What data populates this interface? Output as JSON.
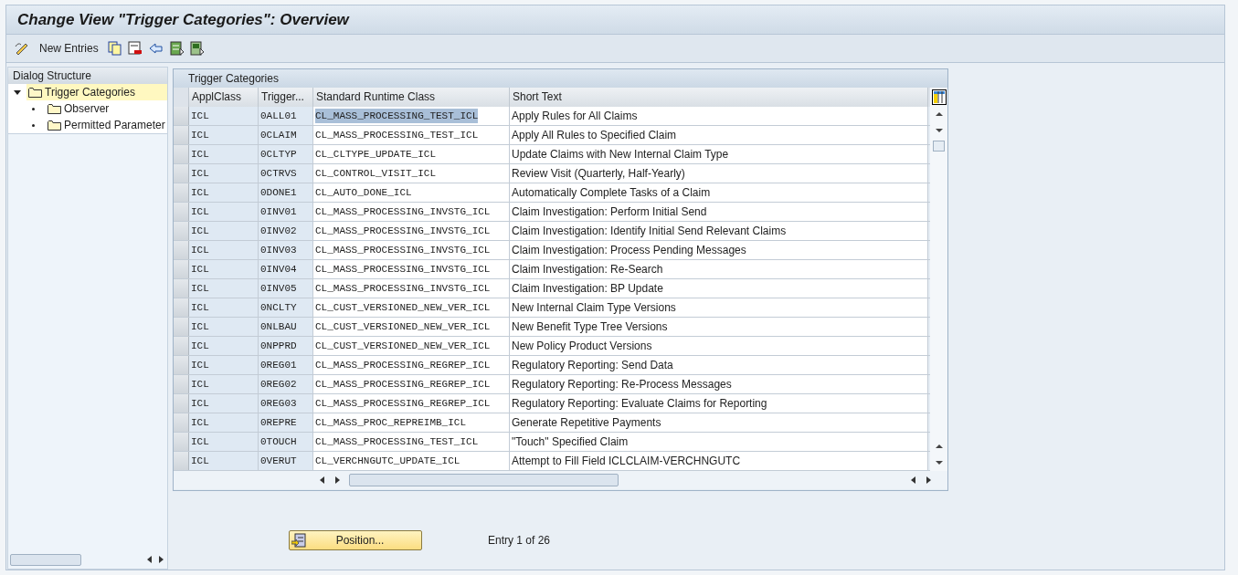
{
  "window": {
    "title": "Change View \"Trigger Categories\": Overview"
  },
  "toolbar": {
    "new_entries": "New Entries"
  },
  "dialog_structure": {
    "title": "Dialog Structure",
    "items": [
      {
        "label": "Trigger Categories",
        "selected": true,
        "expanded": true,
        "children": [
          {
            "label": "Observer",
            "selected": false
          },
          {
            "label": "Permitted Parameter",
            "selected": false
          }
        ]
      }
    ]
  },
  "table": {
    "title": "Trigger Categories",
    "columns": [
      "ApplClass",
      "Trigger...",
      "Standard Runtime Class",
      "Short Text"
    ],
    "rows": [
      {
        "cells": [
          "ICL",
          "0ALL01",
          "CL_MASS_PROCESSING_TEST_ICL",
          "Apply Rules for All Claims"
        ],
        "focused": true
      },
      {
        "cells": [
          "ICL",
          "0CLAIM",
          "CL_MASS_PROCESSING_TEST_ICL",
          "Apply All Rules to Specified Claim"
        ],
        "focused": false
      },
      {
        "cells": [
          "ICL",
          "0CLTYP",
          "CL_CLTYPE_UPDATE_ICL",
          "Update Claims with New Internal Claim Type"
        ],
        "focused": false
      },
      {
        "cells": [
          "ICL",
          "0CTRVS",
          "CL_CONTROL_VISIT_ICL",
          "Review Visit (Quarterly, Half-Yearly)"
        ],
        "focused": false
      },
      {
        "cells": [
          "ICL",
          "0DONE1",
          "CL_AUTO_DONE_ICL",
          "Automatically Complete Tasks of a Claim"
        ],
        "focused": false
      },
      {
        "cells": [
          "ICL",
          "0INV01",
          "CL_MASS_PROCESSING_INVSTG_ICL",
          "Claim Investigation: Perform Initial Send"
        ],
        "focused": false
      },
      {
        "cells": [
          "ICL",
          "0INV02",
          "CL_MASS_PROCESSING_INVSTG_ICL",
          "Claim Investigation: Identify Initial Send Relevant Claims"
        ],
        "focused": false
      },
      {
        "cells": [
          "ICL",
          "0INV03",
          "CL_MASS_PROCESSING_INVSTG_ICL",
          "Claim Investigation: Process Pending Messages"
        ],
        "focused": false
      },
      {
        "cells": [
          "ICL",
          "0INV04",
          "CL_MASS_PROCESSING_INVSTG_ICL",
          "Claim Investigation: Re-Search"
        ],
        "focused": false
      },
      {
        "cells": [
          "ICL",
          "0INV05",
          "CL_MASS_PROCESSING_INVSTG_ICL",
          "Claim Investigation: BP Update"
        ],
        "focused": false
      },
      {
        "cells": [
          "ICL",
          "0NCLTY",
          "CL_CUST_VERSIONED_NEW_VER_ICL",
          "New Internal Claim Type Versions"
        ],
        "focused": false
      },
      {
        "cells": [
          "ICL",
          "0NLBAU",
          "CL_CUST_VERSIONED_NEW_VER_ICL",
          "New Benefit Type Tree Versions"
        ],
        "focused": false
      },
      {
        "cells": [
          "ICL",
          "0NPPRD",
          "CL_CUST_VERSIONED_NEW_VER_ICL",
          "New Policy Product Versions"
        ],
        "focused": false
      },
      {
        "cells": [
          "ICL",
          "0REG01",
          "CL_MASS_PROCESSING_REGREP_ICL",
          "Regulatory Reporting: Send Data"
        ],
        "focused": false
      },
      {
        "cells": [
          "ICL",
          "0REG02",
          "CL_MASS_PROCESSING_REGREP_ICL",
          "Regulatory Reporting: Re-Process Messages"
        ],
        "focused": false
      },
      {
        "cells": [
          "ICL",
          "0REG03",
          "CL_MASS_PROCESSING_REGREP_ICL",
          "Regulatory Reporting: Evaluate Claims for Reporting"
        ],
        "focused": false
      },
      {
        "cells": [
          "ICL",
          "0REPRE",
          "CL_MASS_PROC_REPREIMB_ICL",
          "Generate Repetitive Payments"
        ],
        "focused": false
      },
      {
        "cells": [
          "ICL",
          "0TOUCH",
          "CL_MASS_PROCESSING_TEST_ICL",
          "\"Touch\" Specified Claim"
        ],
        "focused": false
      },
      {
        "cells": [
          "ICL",
          "0VERUT",
          "CL_VERCHNGUTC_UPDATE_ICL",
          "Attempt to Fill Field ICLCLAIM-VERCHNGUTC"
        ],
        "focused": false
      }
    ]
  },
  "position_button": "Position...",
  "entry_info": "Entry 1 of 26"
}
